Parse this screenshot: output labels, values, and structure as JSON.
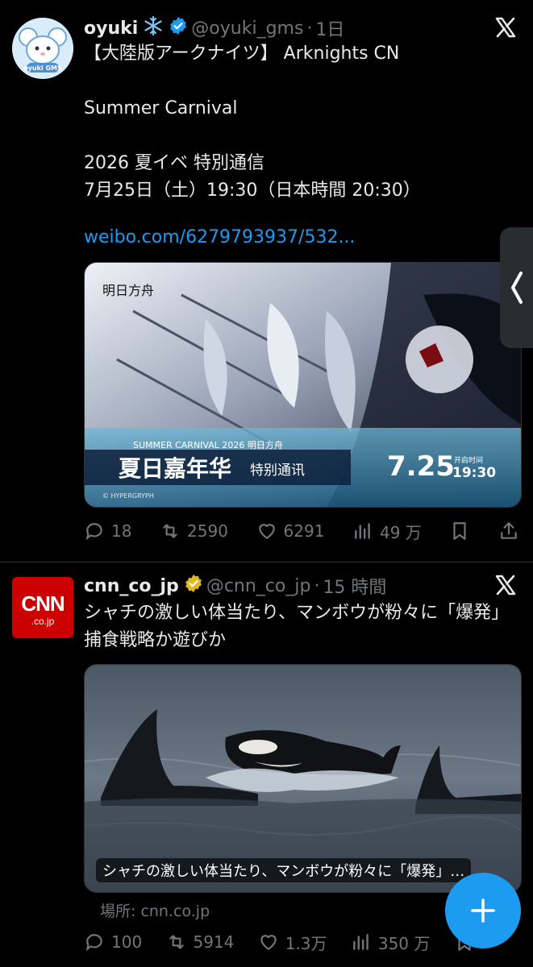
{
  "tweet1": {
    "display_name": "oyuki",
    "handle": "@oyuki_gms",
    "time": "1日",
    "avatar_label": "oyuki GMS",
    "text": "【大陸版アークナイツ】 Arknights CN\n\nSummer Carnival\n\n2026 夏イベ 特別通信\n7月25日（土）19:30（日本時間 20:30）",
    "link": "weibo.com/6279793937/532...",
    "media": {
      "logo_text": "明日方舟",
      "sub_title": "SUMMER CARNIVAL 2026 明日方舟",
      "main_title": "夏日嘉年华",
      "tag": "特别通讯",
      "date": "7.25",
      "time_label": "开启时间",
      "time": "19:30",
      "credit": "© HYPERGRYPH"
    },
    "actions": {
      "replies": "18",
      "retweets": "2590",
      "likes": "6291",
      "views": "49 万"
    }
  },
  "tweet2": {
    "display_name": "cnn_co_jp",
    "handle": "@cnn_co_jp",
    "time": "15 時間",
    "avatar_text": "CNN",
    "avatar_sub": ".co.jp",
    "text": "シャチの激しい体当たり、マンボウが粉々に「爆発」　捕食戦略か遊びか",
    "card_caption": "シャチの激しい体当たり、マンボウが粉々に「爆発」…",
    "source": "場所: cnn.co.jp",
    "actions": {
      "replies": "100",
      "retweets": "5914",
      "likes": "1.3万",
      "views": "350 万"
    }
  },
  "colors": {
    "background": "#000000",
    "text": "#e7e9ea",
    "muted": "#71767b",
    "link": "#1d9bf0",
    "verified_blue": "#1d9bf0",
    "verified_gold": "#e2b719",
    "fab": "#1d9bf0"
  }
}
